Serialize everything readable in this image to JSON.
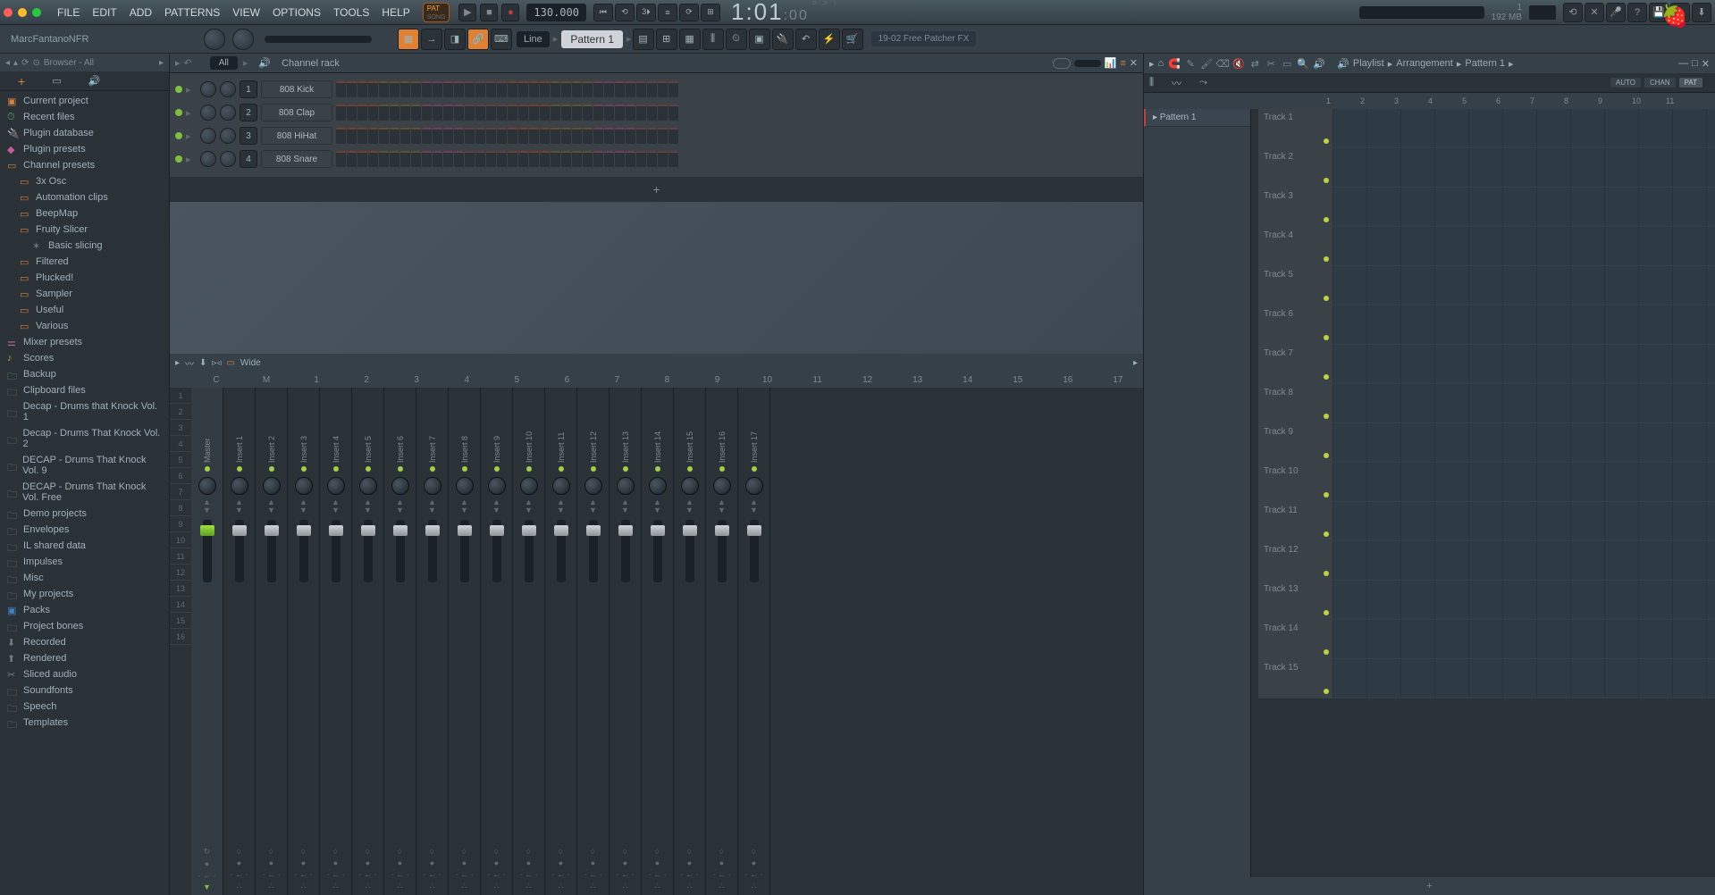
{
  "menu": [
    "FILE",
    "EDIT",
    "ADD",
    "PATTERNS",
    "VIEW",
    "OPTIONS",
    "TOOLS",
    "HELP"
  ],
  "pat_song": "PAT",
  "tempo": "130.000",
  "time_main": "1:01",
  "time_sub": ":00",
  "time_label": "B:S:T",
  "cpu_num": "1",
  "mem": "192 MB",
  "project_name": "MarcFantanoNFR",
  "snap_mode": "Line",
  "pattern_selector": "Pattern 1",
  "patcher_label": "19-02  Free Patcher FX",
  "browser_header": "Browser - All",
  "browser_items": [
    {
      "label": "Current project",
      "icon": "ico-orange",
      "indent": 0,
      "glyph": "▣"
    },
    {
      "label": "Recent files",
      "icon": "ico-green",
      "indent": 0,
      "glyph": "⏱"
    },
    {
      "label": "Plugin database",
      "icon": "ico-blue",
      "indent": 0,
      "glyph": "🔌"
    },
    {
      "label": "Plugin presets",
      "icon": "ico-pink",
      "indent": 0,
      "glyph": "◆"
    },
    {
      "label": "Channel presets",
      "icon": "ico-orange",
      "indent": 0,
      "glyph": "▭"
    },
    {
      "label": "3x Osc",
      "icon": "ico-orange",
      "indent": 1,
      "glyph": "▭"
    },
    {
      "label": "Automation clips",
      "icon": "ico-orange",
      "indent": 1,
      "glyph": "▭"
    },
    {
      "label": "BeepMap",
      "icon": "ico-orange",
      "indent": 1,
      "glyph": "▭"
    },
    {
      "label": "Fruity Slicer",
      "icon": "ico-orange",
      "indent": 1,
      "glyph": "▭"
    },
    {
      "label": "Basic slicing",
      "icon": "ico-gray",
      "indent": 2,
      "glyph": "✶"
    },
    {
      "label": "Filtered",
      "icon": "ico-orange",
      "indent": 1,
      "glyph": "▭"
    },
    {
      "label": "Plucked!",
      "icon": "ico-orange",
      "indent": 1,
      "glyph": "▭"
    },
    {
      "label": "Sampler",
      "icon": "ico-orange",
      "indent": 1,
      "glyph": "▭"
    },
    {
      "label": "Useful",
      "icon": "ico-orange",
      "indent": 1,
      "glyph": "▭"
    },
    {
      "label": "Various",
      "icon": "ico-orange",
      "indent": 1,
      "glyph": "▭"
    },
    {
      "label": "Mixer presets",
      "icon": "ico-pink",
      "indent": 0,
      "glyph": "⚌"
    },
    {
      "label": "Scores",
      "icon": "ico-yellow",
      "indent": 0,
      "glyph": "♪"
    },
    {
      "label": "Backup",
      "icon": "ico-green",
      "indent": 0,
      "glyph": "🗀"
    },
    {
      "label": "Clipboard files",
      "icon": "ico-gray",
      "indent": 0,
      "glyph": "🗀"
    },
    {
      "label": "Decap - Drums that Knock Vol. 1",
      "icon": "ico-gray",
      "indent": 0,
      "glyph": "🗀"
    },
    {
      "label": "Decap - Drums That Knock Vol. 2",
      "icon": "ico-gray",
      "indent": 0,
      "glyph": "🗀"
    },
    {
      "label": "DECAP - Drums That Knock Vol. 9",
      "icon": "ico-gray",
      "indent": 0,
      "glyph": "🗀"
    },
    {
      "label": "DECAP - Drums That Knock Vol. Free",
      "icon": "ico-gray",
      "indent": 0,
      "glyph": "🗀"
    },
    {
      "label": "Demo projects",
      "icon": "ico-gray",
      "indent": 0,
      "glyph": "🗀"
    },
    {
      "label": "Envelopes",
      "icon": "ico-gray",
      "indent": 0,
      "glyph": "🗀"
    },
    {
      "label": "IL shared data",
      "icon": "ico-gray",
      "indent": 0,
      "glyph": "🗀"
    },
    {
      "label": "Impulses",
      "icon": "ico-gray",
      "indent": 0,
      "glyph": "🗀"
    },
    {
      "label": "Misc",
      "icon": "ico-gray",
      "indent": 0,
      "glyph": "🗀"
    },
    {
      "label": "My projects",
      "icon": "ico-gray",
      "indent": 0,
      "glyph": "🗀"
    },
    {
      "label": "Packs",
      "icon": "ico-blue",
      "indent": 0,
      "glyph": "▣"
    },
    {
      "label": "Project bones",
      "icon": "ico-gray",
      "indent": 0,
      "glyph": "🗀"
    },
    {
      "label": "Recorded",
      "icon": "ico-gray",
      "indent": 0,
      "glyph": "⬇"
    },
    {
      "label": "Rendered",
      "icon": "ico-gray",
      "indent": 0,
      "glyph": "⬆"
    },
    {
      "label": "Sliced audio",
      "icon": "ico-gray",
      "indent": 0,
      "glyph": "✂"
    },
    {
      "label": "Soundfonts",
      "icon": "ico-gray",
      "indent": 0,
      "glyph": "🗀"
    },
    {
      "label": "Speech",
      "icon": "ico-gray",
      "indent": 0,
      "glyph": "🗀"
    },
    {
      "label": "Templates",
      "icon": "ico-gray",
      "indent": 0,
      "glyph": "🗀"
    }
  ],
  "channel_rack": {
    "title": "Channel rack",
    "filter": "All",
    "channels": [
      {
        "num": "1",
        "name": "808 Kick"
      },
      {
        "num": "2",
        "name": "808 Clap"
      },
      {
        "num": "3",
        "name": "808 HiHat"
      },
      {
        "num": "4",
        "name": "808 Snare"
      }
    ]
  },
  "mixer": {
    "view": "Wide",
    "labels": [
      "C",
      "M",
      "1",
      "2",
      "3",
      "4",
      "5",
      "6",
      "7",
      "8",
      "9",
      "10",
      "11",
      "12",
      "13",
      "14",
      "15",
      "16",
      "17"
    ],
    "side_nums": [
      "1",
      "2",
      "3",
      "4",
      "5",
      "6",
      "7",
      "8",
      "9",
      "10",
      "11",
      "12",
      "13",
      "14",
      "15",
      "16"
    ],
    "tracks": [
      "Master",
      "Insert 1",
      "Insert 2",
      "Insert 3",
      "Insert 4",
      "Insert 5",
      "Insert 6",
      "Insert 7",
      "Insert 8",
      "Insert 9",
      "Insert 10",
      "Insert 11",
      "Insert 12",
      "Insert 13",
      "Insert 14",
      "Insert 15",
      "Insert 16",
      "Insert 17"
    ]
  },
  "playlist": {
    "title": "Playlist",
    "arrangement": "Arrangement",
    "pattern": "Pattern 1",
    "patterns": [
      "Pattern 1"
    ],
    "tabs": [
      "AUTO",
      "CHAN",
      "PAT"
    ],
    "ruler": [
      "1",
      "2",
      "3",
      "4",
      "5",
      "6",
      "7",
      "8",
      "9",
      "10",
      "11"
    ],
    "tracks": [
      "Track 1",
      "Track 2",
      "Track 3",
      "Track 4",
      "Track 5",
      "Track 6",
      "Track 7",
      "Track 8",
      "Track 9",
      "Track 10",
      "Track 11",
      "Track 12",
      "Track 13",
      "Track 14",
      "Track 15"
    ]
  }
}
